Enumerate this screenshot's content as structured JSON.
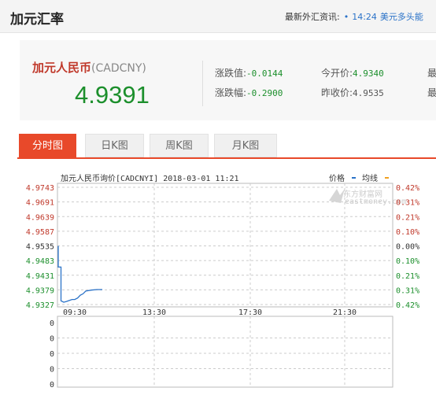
{
  "header": {
    "title": "加元汇率",
    "news_label": "最新外汇资讯:",
    "news_bullet": "•",
    "news_time": "14:24",
    "news_headline": "美元多头能"
  },
  "quote": {
    "name": "加元人民币",
    "code": "(CADCNY)",
    "price": "4.9391",
    "stats": [
      {
        "label": "涨跌值:",
        "value": "-0.0144"
      },
      {
        "label": "今开价:",
        "value": "4.9340"
      },
      {
        "label": "涨跌幅:",
        "value": "-0.2900"
      },
      {
        "label": "昨收价:",
        "value": "4.9535"
      }
    ],
    "cutoff_labels": [
      "最",
      "最"
    ]
  },
  "tabs": [
    {
      "label": "分时图",
      "active": true
    },
    {
      "label": "日K图",
      "active": false
    },
    {
      "label": "周K图",
      "active": false
    },
    {
      "label": "月K图",
      "active": false
    }
  ],
  "chart_data": {
    "type": "line",
    "title": "加元人民币询价[CADCNYI] 2018-03-01 11:21",
    "legend": [
      {
        "name": "价格",
        "color": "#2a72c8"
      },
      {
        "name": "均线",
        "color": "#f0a020"
      }
    ],
    "watermark": {
      "brand": "东方财富网",
      "domain": "eastmoney.com"
    },
    "y_ticks_left": [
      "4.9743",
      "4.9691",
      "4.9639",
      "4.9587",
      "4.9535",
      "4.9483",
      "4.9431",
      "4.9379",
      "4.9327"
    ],
    "y_ticks_right": [
      "0.42%",
      "0.31%",
      "0.21%",
      "0.10%",
      "0.00%",
      "0.10%",
      "0.21%",
      "0.31%",
      "0.42%"
    ],
    "ylim": [
      4.9327,
      4.9743
    ],
    "prev_close": 4.9535,
    "x_ticks": [
      "09:30",
      "13:30",
      "17:30",
      "21:30"
    ],
    "series": [
      {
        "name": "价格",
        "x": [
          0,
          0,
          1,
          1,
          2,
          3,
          5,
          6,
          7,
          8,
          9,
          10,
          12,
          14,
          16
        ],
        "values": [
          4.9535,
          4.946,
          4.946,
          4.934,
          4.9335,
          4.9338,
          4.9345,
          4.9345,
          4.935,
          4.936,
          4.9365,
          4.9375,
          4.9378,
          4.938,
          4.938
        ]
      }
    ],
    "volume_ticks": [
      "0",
      "0",
      "0",
      "0",
      "0"
    ],
    "colors": {
      "up": "#c0392b",
      "down": "#1c8f2c",
      "neutral": "#333333",
      "line": "#2a72c8"
    }
  }
}
